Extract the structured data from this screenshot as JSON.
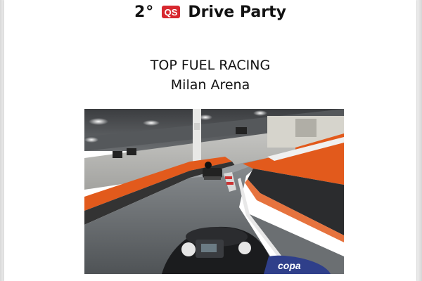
{
  "header": {
    "ordinal": "2°",
    "logo_text": "QS",
    "event_name": "Drive Party"
  },
  "team": {
    "name": "TOP FUEL RACING",
    "venue": "Milan Arena"
  },
  "photo": {
    "subject": "go-kart-track-image",
    "brand_on_kart": "copa"
  },
  "colors": {
    "logo_red": "#d7282f",
    "barrier_orange": "#e25a1c",
    "track_gray": "#5e6266"
  }
}
